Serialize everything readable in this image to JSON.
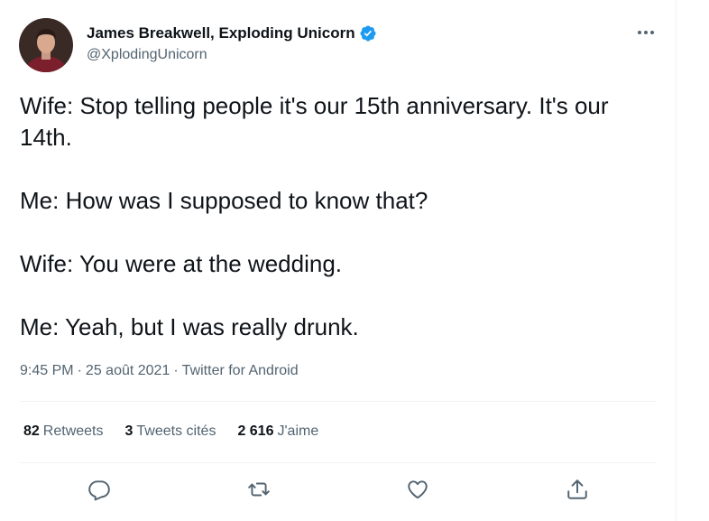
{
  "author": {
    "display_name": "James Breakwell, Exploding Unicorn",
    "handle": "@XplodingUnicorn",
    "verified": true
  },
  "tweet": {
    "lines": [
      "Wife: Stop telling people it's our 15th anniversary. It's our 14th.",
      "Me: How was I supposed to know that?",
      "Wife: You were at the wedding.",
      "Me: Yeah, but I was really drunk."
    ],
    "time": "9:45 PM",
    "date": "25 août 2021",
    "source": "Twitter for Android",
    "separator": "·"
  },
  "stats": {
    "retweets": {
      "value": "82",
      "label": "Retweets"
    },
    "quotes": {
      "value": "3",
      "label": "Tweets cités"
    },
    "likes": {
      "value": "2 616",
      "label": "J'aime"
    }
  },
  "icons": {
    "reply": "reply-icon",
    "retweet": "retweet-icon",
    "like": "heart-icon",
    "share": "share-icon",
    "more": "more-icon",
    "verified": "verified-badge-icon"
  },
  "colors": {
    "text_primary": "#0f1419",
    "text_secondary": "#536471",
    "verified_blue": "#1d9bf0",
    "divider": "#eff3f4"
  }
}
